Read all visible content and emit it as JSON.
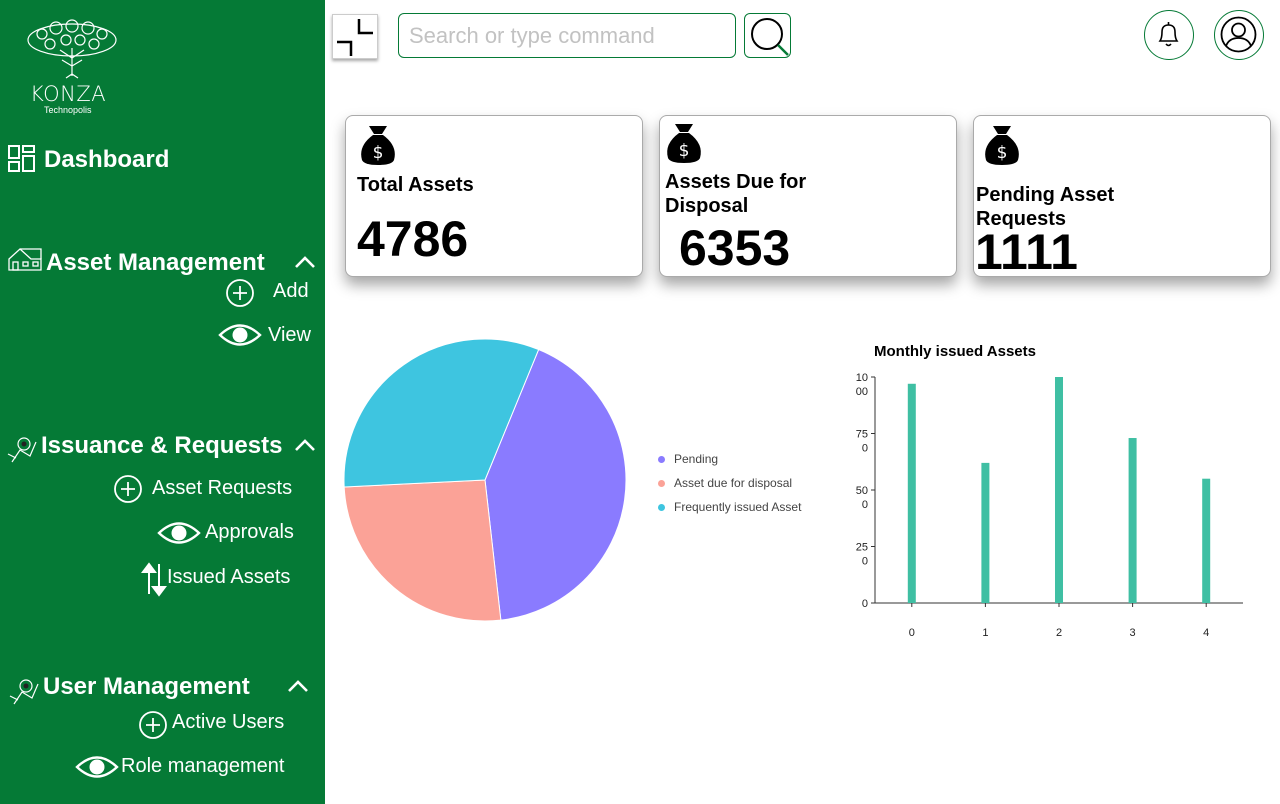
{
  "app": {
    "logo_text": "KONZA",
    "logo_sub": "Technopolis"
  },
  "sidebar": {
    "dashboard": {
      "label": "Dashboard",
      "icon": "dashboard-grid-icon"
    },
    "asset_management": {
      "label": "Asset Management",
      "icon": "house-icon",
      "items": [
        {
          "label": "Add",
          "icon": "plus-circle-icon"
        },
        {
          "label": "View",
          "icon": "eye-icon"
        }
      ]
    },
    "issuance": {
      "label": "Issuance & Requests",
      "icon": "issuance-icon",
      "items": [
        {
          "label": "Asset Requests",
          "icon": "plus-circle-icon"
        },
        {
          "label": "Approvals",
          "icon": "eye-icon"
        },
        {
          "label": "Issued Assets",
          "icon": "up-down-arrows-icon"
        }
      ]
    },
    "user_management": {
      "label": "User Management",
      "icon": "users-icon",
      "items": [
        {
          "label": "Active Users",
          "icon": "plus-circle-icon"
        },
        {
          "label": "Role management",
          "icon": "eye-icon"
        }
      ]
    }
  },
  "topbar": {
    "search_placeholder": "Search or type command"
  },
  "cards": [
    {
      "title_line1": "Total Assets",
      "title_line2": "",
      "value": "4786",
      "icon": "money-bag-icon"
    },
    {
      "title_line1": "Assets Due for",
      "title_line2": "Disposal",
      "value": "6353",
      "icon": "money-bag-icon"
    },
    {
      "title_line1": "Pending Asset",
      "title_line2": "Requests",
      "value": "1111",
      "icon": "money-bag-icon"
    }
  ],
  "colors": {
    "brand_green": "#057a36",
    "pie_pending": "#8a7bff",
    "pie_disposal": "#fba297",
    "pie_issued": "#3ec5e0",
    "bar": "#3fbfa3"
  },
  "chart_data": [
    {
      "type": "pie",
      "labels": [
        "Pending",
        "Asset due for disposal",
        "Frequently issued Asset"
      ],
      "values": [
        42,
        26,
        32
      ],
      "legend_position": "right"
    },
    {
      "type": "bar",
      "title": "Monthly issued Assets",
      "categories": [
        "0",
        "1",
        "2",
        "3",
        "4"
      ],
      "values": [
        970,
        620,
        1000,
        730,
        550
      ],
      "ylim": [
        0,
        1000
      ],
      "yticks": [
        {
          "v": 0,
          "l1": "0",
          "l2": ""
        },
        {
          "v": 250,
          "l1": "25",
          "l2": "0"
        },
        {
          "v": 500,
          "l1": "50",
          "l2": "0"
        },
        {
          "v": 750,
          "l1": "75",
          "l2": "0"
        },
        {
          "v": 1000,
          "l1": "10",
          "l2": "00"
        }
      ],
      "grid": false
    }
  ]
}
